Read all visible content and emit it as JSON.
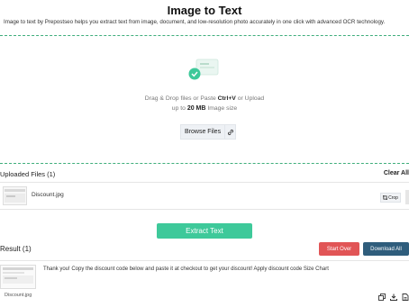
{
  "page": {
    "title": "Image to Text",
    "subtitle": "Image to text by Prepostseo helps you extract text from image, document, and low-resolution photo accurately in one click with advanced OCR technology."
  },
  "dropzone": {
    "text_before": "Drag & Drop files or Paste ",
    "shortcut": "Ctrl+V",
    "text_after": " or Upload",
    "limit_prefix": "up to ",
    "limit_size": "20 MB",
    "limit_suffix": " Image size",
    "browse_label": "Browse Files",
    "icons": {
      "illustration": "upload-illustration-icon",
      "link": "link-icon"
    }
  },
  "uploaded": {
    "title": "Uploaded Files (1)",
    "clear_all": "Clear All",
    "files": [
      {
        "name": "Discount.jpg",
        "crop_label": "Crop"
      }
    ]
  },
  "actions": {
    "extract_label": "Extract Text"
  },
  "result": {
    "title": "Result (1)",
    "start_over": "Start Over",
    "download_all": "Download All",
    "items": [
      {
        "file_name": "Discount.jpg",
        "text": "Thank you! Copy the discount code below and paste it at checkout to get your discount! Apply discount code Size Chart"
      }
    ],
    "icons": [
      "copy-icon",
      "download-icon",
      "file-icon"
    ]
  },
  "colors": {
    "accent_green": "#3ec99a",
    "dashed_border": "#3fae7c",
    "start_over_red": "#e15556",
    "download_blue": "#2f5d7c"
  }
}
